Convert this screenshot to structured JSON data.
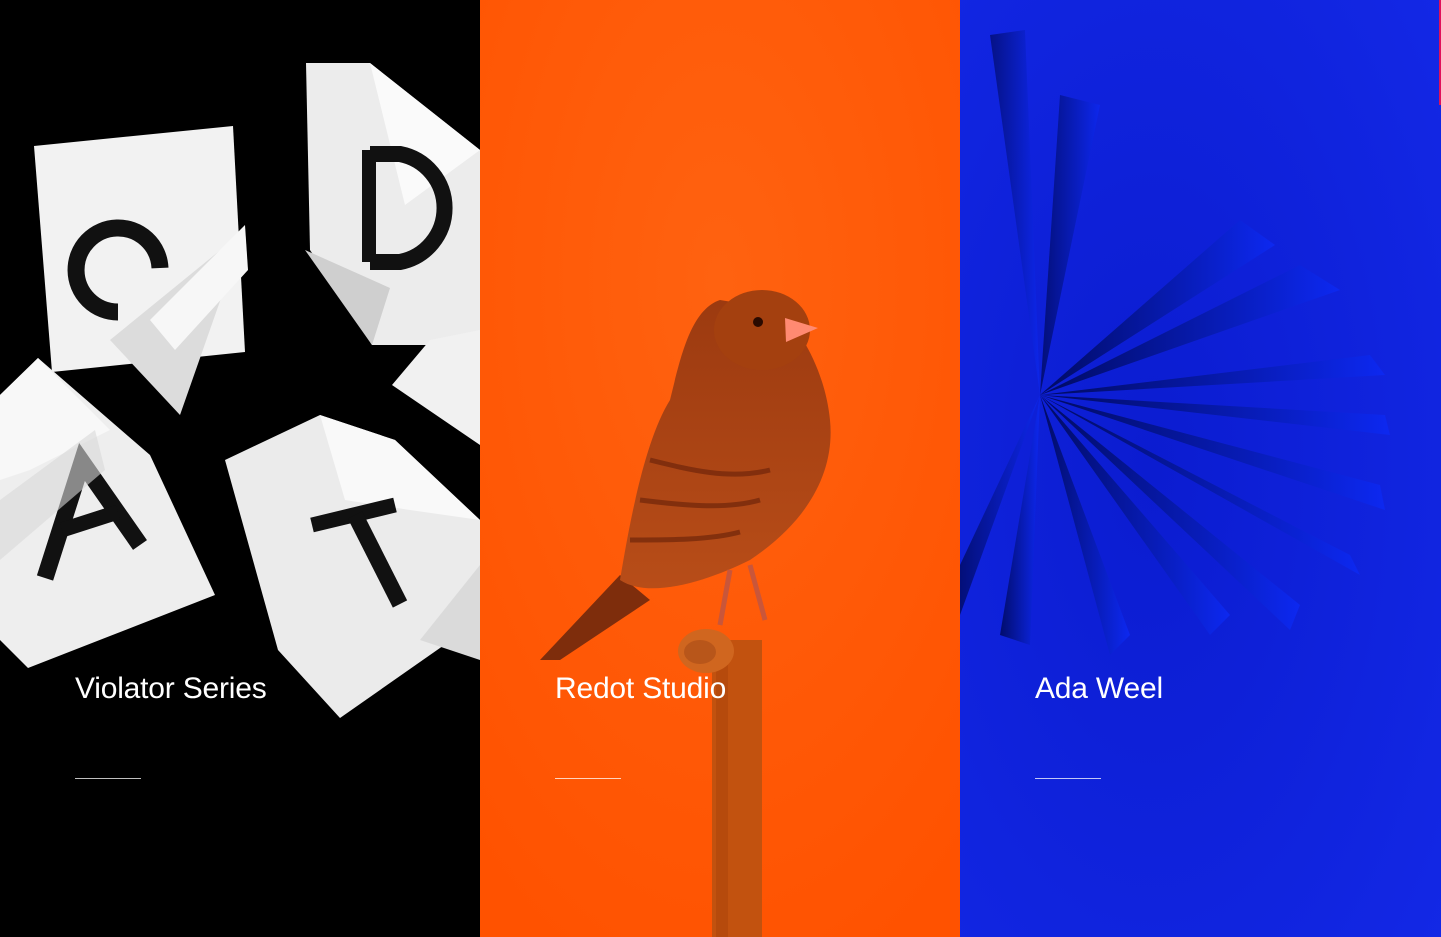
{
  "projects": [
    {
      "title": "Violator Series",
      "background": "#000000",
      "image": "folded-paper-letters-artwork"
    },
    {
      "title": "Redot Studio",
      "background": "#ff5a0a",
      "image": "bird-on-perch-artwork"
    },
    {
      "title": "Ada Weel",
      "background": "#1126e0",
      "image": "fanned-book-pages-artwork"
    }
  ]
}
